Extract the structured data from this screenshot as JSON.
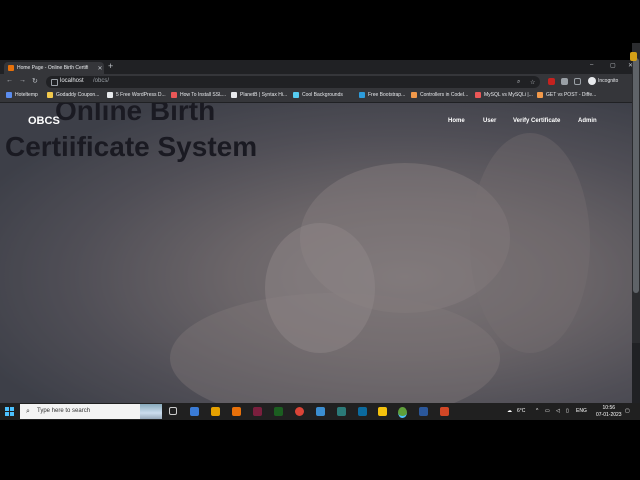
{
  "browser": {
    "tab_title": "Home Page - Online Birth Certifi",
    "tab_close": "✕",
    "new_tab": "+",
    "window_controls": [
      "–",
      "▢",
      "✕"
    ],
    "nav": {
      "back": "←",
      "forward": "→",
      "reload": "↻"
    },
    "url_host": "localhost",
    "url_path": "/obcs/",
    "profile_label": "Incognito",
    "menu": "⋮",
    "bookmarks": [
      {
        "label": "Hoteltemp",
        "color": "#5b8def"
      },
      {
        "label": "Godaddy Coupon...",
        "color": "#f2c94c"
      },
      {
        "label": "5 Free WordPress D...",
        "color": "#e8eaed"
      },
      {
        "label": "How To Install SSL...",
        "color": "#eb5757"
      },
      {
        "label": "PlanetB | Syntax Hi...",
        "color": "#e8eaed"
      },
      {
        "label": "Cool Backgrounds",
        "color": "#56ccf2"
      },
      {
        "label": "Free Bootstrap...",
        "color": "#2d9cdb"
      },
      {
        "label": "Controllers in CodeI...",
        "color": "#f2994a"
      },
      {
        "label": "MySQL vs MySQLi |...",
        "color": "#eb5757"
      },
      {
        "label": "GET vs POST - Diffe...",
        "color": "#f2994a"
      }
    ]
  },
  "site": {
    "brand": "OBCS",
    "nav": [
      "Home",
      "User",
      "Verify Certificate",
      "Admin"
    ],
    "headline_line1": "Online Birth",
    "headline_line2": "Certiificate System"
  },
  "taskbar": {
    "search_placeholder": "Type here to search",
    "weather": "6°C",
    "language": "ENG",
    "time": "10:56",
    "date": "07-01-2023"
  }
}
